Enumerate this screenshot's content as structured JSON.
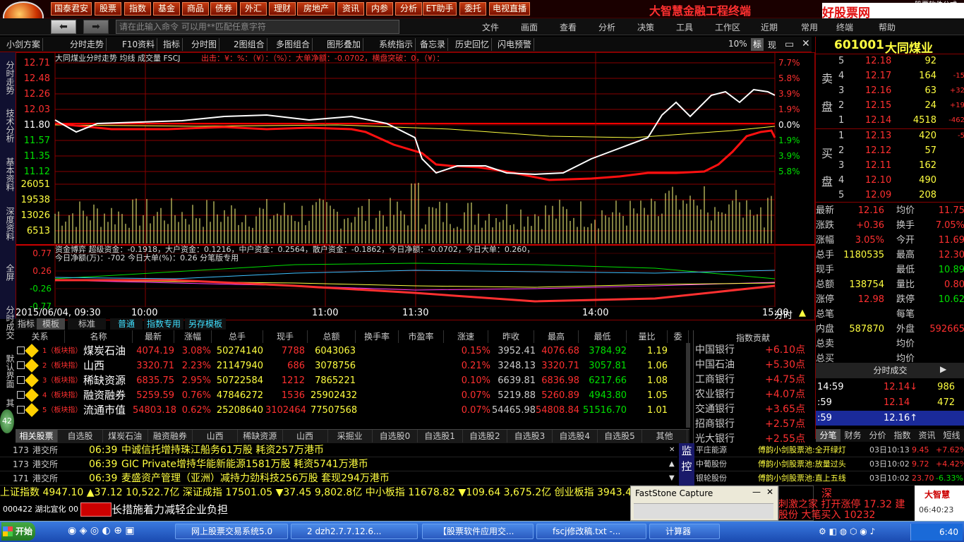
{
  "topmenu": [
    "国泰君安",
    "股票",
    "指数",
    "基金",
    "商品",
    "债券",
    "外汇",
    "理财",
    "房地产",
    "资讯",
    "内参",
    "分析",
    "ET助手",
    "委托",
    "电视直播"
  ],
  "brand_title": "大智慧金融工程终端",
  "site_logo": "好股票网Goodgupiao.com",
  "site_sub": "股票软件公式",
  "cmd_placeholder": "请在此输入命令   可以用**匹配任意字符",
  "menus": [
    "文件",
    "画面",
    "查看",
    "分析",
    "决策",
    "工具",
    "工作区",
    "近期",
    "常用",
    "终端",
    "帮助"
  ],
  "tabs": [
    "小剑方案",
    "分时走势",
    "F10资料",
    "指标",
    "分时图",
    "2图组合",
    "多图组合",
    "图形叠加",
    "系统指示",
    "备忘录",
    "历史回忆",
    "闪电预警"
  ],
  "zoom": "10%",
  "tab_biao": "标",
  "tab_xian": "现",
  "sidetabs": [
    "分时走势",
    "技术分析",
    "基本资料",
    "深度资料",
    "全屏",
    "分时成交",
    "默认界面",
    "其"
  ],
  "chart_header": "大同煤业分时走势 均线 成交量 FSCJ",
  "chart_header2": "出击：¥：%：（¥）：（%）：大单净额：-0.0702，横盘突破：0，（¥）：",
  "price_ticks": [
    "12.71",
    "12.48",
    "12.26",
    "12.03",
    "11.80",
    "11.57",
    "11.35",
    "11.12"
  ],
  "pct_ticks": [
    "7.7%",
    "5.8%",
    "3.9%",
    "1.9%",
    "0.0%",
    "1.9%",
    "3.9%",
    "5.8%"
  ],
  "vol_ticks": [
    "26051",
    "19538",
    "13026",
    "6513"
  ],
  "fund_header": "资金博弈 超级资金：-0.1918，大户资金：0.1216，中户资金：0.2564，散户资金：-0.1862，今日净额：-0.0702，今日大单：0.260，",
  "fund_header2": "今日净额(万)：-702 今日大单(%)：0.26 分笔版专用",
  "fund_ticks": [
    "0.77",
    "0.26",
    "-0.26",
    "-0.77"
  ],
  "time_ticks": [
    "2015/06/04, 09:30",
    "10:00",
    "11:00",
    "11:30",
    "14:00",
    "15:00"
  ],
  "fenshi": "分时",
  "stock": {
    "code": "601001",
    "name": "大同煤业"
  },
  "sell": [
    {
      "n": "5",
      "p": "12.18",
      "v": "92",
      "c": ""
    },
    {
      "n": "4",
      "p": "12.17",
      "v": "164",
      "c": "-15"
    },
    {
      "n": "3",
      "p": "12.16",
      "v": "63",
      "c": "+32"
    },
    {
      "n": "2",
      "p": "12.15",
      "v": "24",
      "c": "+19"
    },
    {
      "n": "1",
      "p": "12.14",
      "v": "4518",
      "c": "-462"
    }
  ],
  "buy": [
    {
      "n": "1",
      "p": "12.13",
      "v": "420",
      "c": "-5"
    },
    {
      "n": "2",
      "p": "12.12",
      "v": "57",
      "c": ""
    },
    {
      "n": "3",
      "p": "12.11",
      "v": "162",
      "c": ""
    },
    {
      "n": "4",
      "p": "12.10",
      "v": "490",
      "c": ""
    },
    {
      "n": "5",
      "p": "12.09",
      "v": "208",
      "c": ""
    }
  ],
  "sell_label": [
    "卖",
    "盘"
  ],
  "buy_label": [
    "买",
    "盘"
  ],
  "quote": [
    [
      "最新",
      "12.16",
      "均价",
      "11.75"
    ],
    [
      "涨跌",
      "+0.36",
      "换手",
      "7.05%"
    ],
    [
      "涨幅",
      "3.05%",
      "今开",
      "11.69"
    ],
    [
      "总手",
      "1180535",
      "最高",
      "12.30"
    ],
    [
      "现手",
      "",
      "最低",
      "10.89"
    ],
    [
      "总额",
      "138754",
      "量比",
      "0.80"
    ],
    [
      "涨停",
      "12.98",
      "跌停",
      "10.62"
    ],
    [
      "总笔",
      "",
      "每笔",
      ""
    ],
    [
      "内盘",
      "587870",
      "外盘",
      "592665"
    ],
    [
      "总卖",
      "",
      "均价",
      ""
    ],
    [
      "总买",
      "",
      "均价",
      ""
    ]
  ],
  "fenshi_title": "分时成交",
  "ticks": [
    [
      "14:59",
      "12.14↓",
      "986"
    ],
    [
      ":59",
      "12.14",
      "472"
    ],
    [
      ":59",
      "12.16↑",
      ""
    ]
  ],
  "rtabs": [
    "分笔",
    "财务",
    "分价",
    "指数",
    "资讯",
    "短线"
  ],
  "tbl_tabs": [
    "指标",
    "模板",
    "标准",
    "普通",
    "指数专用",
    "另存模板"
  ],
  "tbl_heads": [
    "关系",
    "名称",
    "最新",
    "涨幅",
    "总手",
    "现手",
    "总额",
    "换手率",
    "市盈率",
    "涨速",
    "昨收",
    "最高",
    "最低",
    "量比",
    "委"
  ],
  "rows": [
    [
      "1（板块指）",
      "煤炭石油",
      "4074.19",
      "3.08%",
      "50274140",
      "7788",
      "6043063",
      "",
      "",
      "0.15%",
      "3952.41",
      "4076.68",
      "3784.92",
      "1.19"
    ],
    [
      "2（板块指）",
      "山西",
      "3320.71",
      "2.23%",
      "21147940",
      "686",
      "3078756",
      "",
      "",
      "0.21%",
      "3248.13",
      "3320.71",
      "3057.81",
      "1.06"
    ],
    [
      "3（板块指）",
      "稀缺资源",
      "6835.75",
      "2.95%",
      "50722584",
      "1212",
      "7865221",
      "",
      "",
      "0.10%",
      "6639.81",
      "6836.98",
      "6217.66",
      "1.08"
    ],
    [
      "4（板块指）",
      "融资融券",
      "5259.59",
      "0.76%",
      "47846272",
      "1536",
      "25902432",
      "",
      "",
      "0.07%",
      "5219.88",
      "5260.89",
      "4943.80",
      "1.05"
    ],
    [
      "5（板块指）",
      "流通市值",
      "54803.18",
      "0.62%",
      "25208640",
      "3102464",
      "77507568",
      "",
      "",
      "0.07%",
      "54465.98",
      "54808.84",
      "51516.70",
      "1.01"
    ]
  ],
  "idx_title": "指数贡献",
  "idx": [
    [
      "中国银行",
      "+6.10点"
    ],
    [
      "中国石油",
      "+5.30点"
    ],
    [
      "工商银行",
      "+4.75点"
    ],
    [
      "农业银行",
      "+4.07点"
    ],
    [
      "交通银行",
      "+3.65点"
    ],
    [
      "招商银行",
      "+2.57点"
    ],
    [
      "光大银行",
      "+2.55点"
    ]
  ],
  "subtabs": [
    "相关股票",
    "自选股",
    "煤炭石油",
    "融资融券",
    "山西",
    "稀缺资源",
    "山西",
    "采掘业",
    "自选股0",
    "自选股1",
    "自选股2",
    "自选股3",
    "自选股4",
    "自选股5",
    "其他"
  ],
  "news": [
    [
      "173",
      "港交所",
      "06:39",
      "中诚信托增持珠江船务61万股 耗资257万港币"
    ],
    [
      "173",
      "港交所",
      "06:39",
      "GIC Private增持华能新能源1581万股 耗资5741万港币"
    ],
    [
      "171",
      "港交所",
      "06:39",
      "麦盛资产管理（亚洲）减持力劲科技256万股 套现294万港币"
    ]
  ],
  "watch": [
    [
      "平庄能源",
      "傅韵小剑股票池:全开绿灯",
      "03日10:13",
      "9.45",
      "+7.62%"
    ],
    [
      "中葡股份",
      "傅韵小剑股票池:放量过头",
      "03日10:02",
      "9.72",
      "+4.42%"
    ],
    [
      "银轮股份",
      "傅韵小剑股票池:直上五线",
      "03日10:02",
      "23.70",
      "-6.33%"
    ]
  ],
  "watch_labels": [
    "监",
    "控"
  ],
  "market": "上证指数 4947.10 ▲37.12 10,522.7亿 深证成指 17501.05 ▼37.45 9,802.8亿 中小板指 11678.82 ▼109.64 3,675.2亿 创业板指 3943.4",
  "msg_code": "000422 湖北宜化 00",
  "msg_text": "长措施着力减轻企业负担",
  "scroll_msg": "刺激之家 打开涨停 17.32 建股份 大笔买入 10232",
  "shen": "深",
  "fs_title": "FastStone Capture",
  "badge": "42",
  "tasks": [
    "开始",
    "网上股票交易系统5.0",
    "2 dzh2.7.7.12.6...",
    "【股票软件应用交...",
    "fscj修改稿.txt -...",
    "计算器"
  ],
  "clock": "6:40",
  "clock2": "06:40:23",
  "dzh": "大智慧",
  "ui_colors": {
    "up": "#ff3030",
    "down": "#00e000",
    "accent": "#ffff40"
  }
}
